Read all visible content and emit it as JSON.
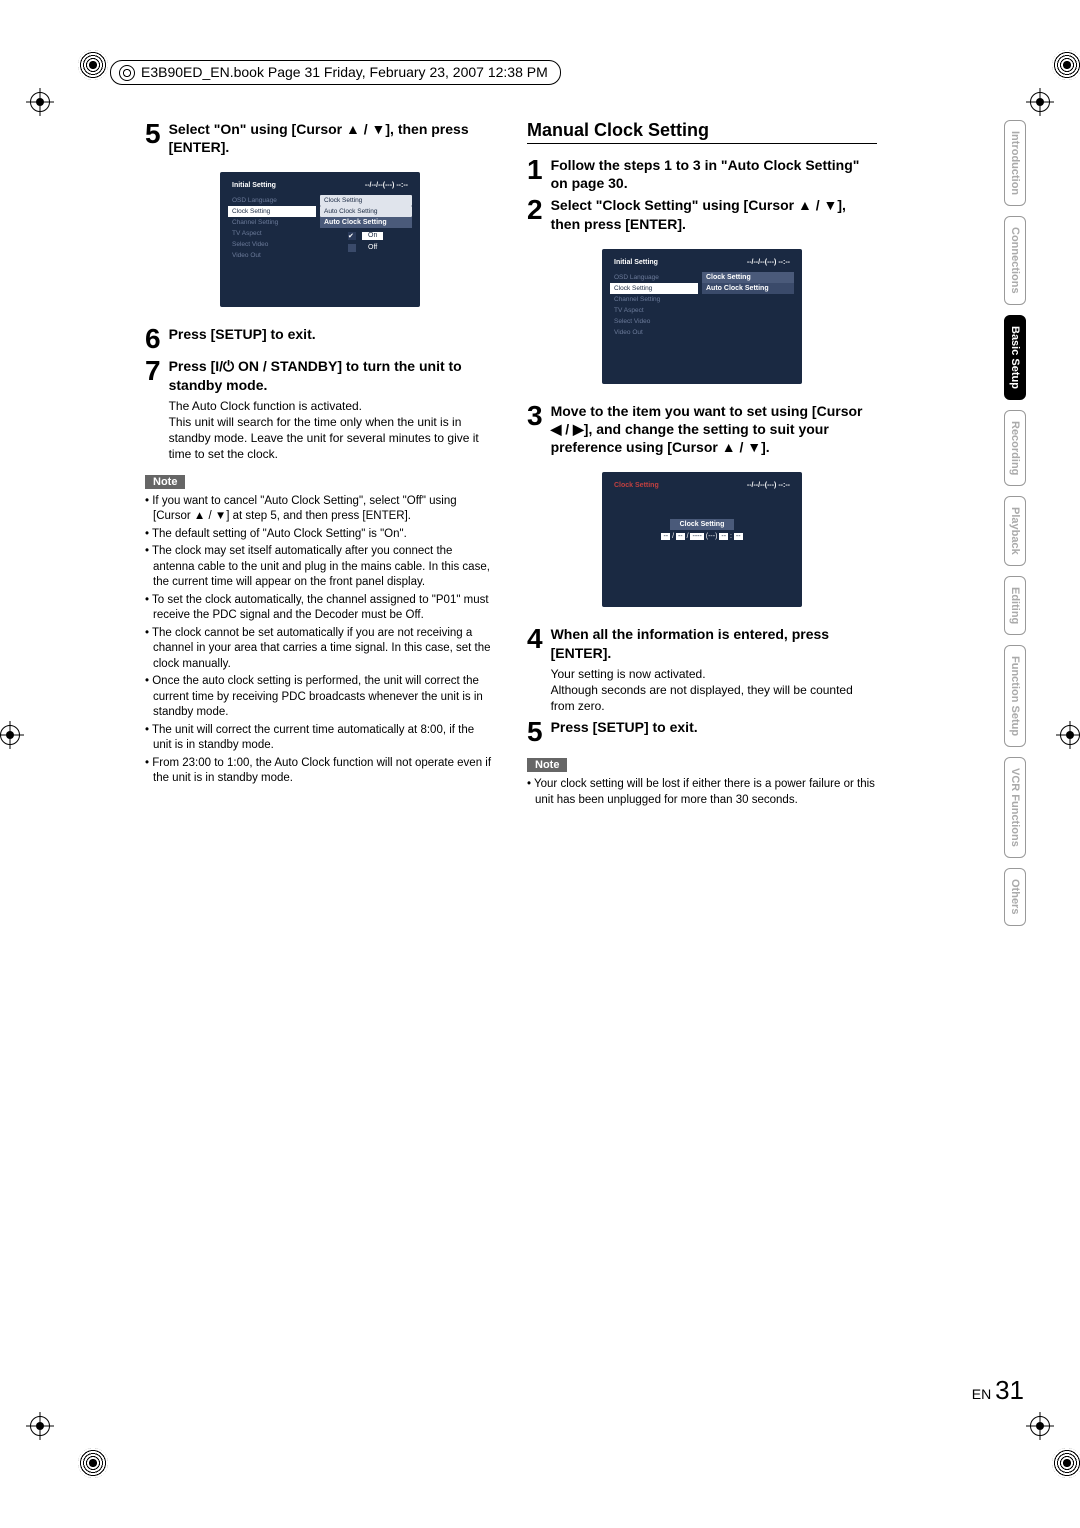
{
  "pageMeta": "E3B90ED_EN.book  Page 31  Friday, February 23, 2007  12:38 PM",
  "left": {
    "step5": "Select \"On\" using [Cursor ▲ / ▼], then press [ENTER].",
    "step6": "Press [SETUP] to exit.",
    "step7": "Press [I/⏻ ON / STANDBY] to turn the unit to standby mode.",
    "step7body": "The Auto Clock function is activated.\nThis unit will search for the time only when the unit is in standby mode. Leave the unit for several minutes to give it time to set the clock.",
    "noteLabel": "Note",
    "notes": [
      "If you want to cancel \"Auto Clock Setting\", select \"Off\" using [Cursor ▲ / ▼] at step 5, and then press [ENTER].",
      "The default setting of \"Auto Clock Setting\" is \"On\".",
      "The clock may set itself automatically after you connect the antenna cable to the unit and plug in the mains cable. In this case, the current time will appear on the front panel display.",
      "To set the clock automatically, the channel assigned to \"P01\" must receive the PDC signal and the Decoder must be Off.",
      "The clock cannot be set automatically if you are not receiving a channel in your area that carries a time signal. In this case, set the clock manually.",
      "Once the auto clock setting is performed, the unit will correct the current time by receiving PDC broadcasts whenever the unit is in standby mode.",
      "The unit will correct the current time automatically at 8:00, if the unit is in standby mode.",
      "From 23:00 to 1:00, the Auto Clock function will not operate even if the unit is in standby mode."
    ]
  },
  "right": {
    "sectionTitle": "Manual Clock Setting",
    "step1": "Follow the steps 1 to 3 in \"Auto Clock Setting\" on page 30.",
    "step2": "Select \"Clock Setting\" using [Cursor ▲ / ▼], then press [ENTER].",
    "step3": "Move to the item you want to set using [Cursor ◀ / ▶], and change the setting to suit your preference using [Cursor ▲ / ▼].",
    "step4": "When all the information is entered, press [ENTER].",
    "step4body": "Your setting is now activated.\nAlthough seconds are not displayed, they will be counted from zero.",
    "step5": "Press [SETUP] to exit.",
    "noteLabel": "Note",
    "notes": [
      "Your clock setting will be lost if either there is a power failure or this unit has been unplugged for more than 30 seconds."
    ]
  },
  "osd1": {
    "title": "Initial Setting",
    "time": "--/--/--(---)   --:--",
    "menuItems": [
      "OSD Language",
      "Clock Setting",
      "Channel Setting",
      "TV Aspect",
      "Select Video",
      "Video Out"
    ],
    "subItems": [
      "Clock Setting",
      "Auto Clock Setting"
    ],
    "panelHeader": "Auto Clock Setting",
    "on": "On",
    "off": "Off"
  },
  "osd2": {
    "title": "Initial Setting",
    "time": "--/--/--(---)   --:--",
    "menuItems": [
      "OSD Language",
      "Clock Setting",
      "Channel Setting",
      "TV Aspect",
      "Select Video",
      "Video Out"
    ],
    "panelItems": [
      "Clock Setting",
      "Auto Clock Setting"
    ]
  },
  "osd3": {
    "title": "Clock Setting",
    "time": "--/--/--(---)   --:--",
    "header": "Clock Setting",
    "value": "-- / -- / ---- (---)  -- : --"
  },
  "tabs": [
    "Introduction",
    "Connections",
    "Basic Setup",
    "Recording",
    "Playback",
    "Editing",
    "Function Setup",
    "VCR Functions",
    "Others"
  ],
  "activeTab": 2,
  "pageLabel": "EN",
  "pageNumber": "31"
}
